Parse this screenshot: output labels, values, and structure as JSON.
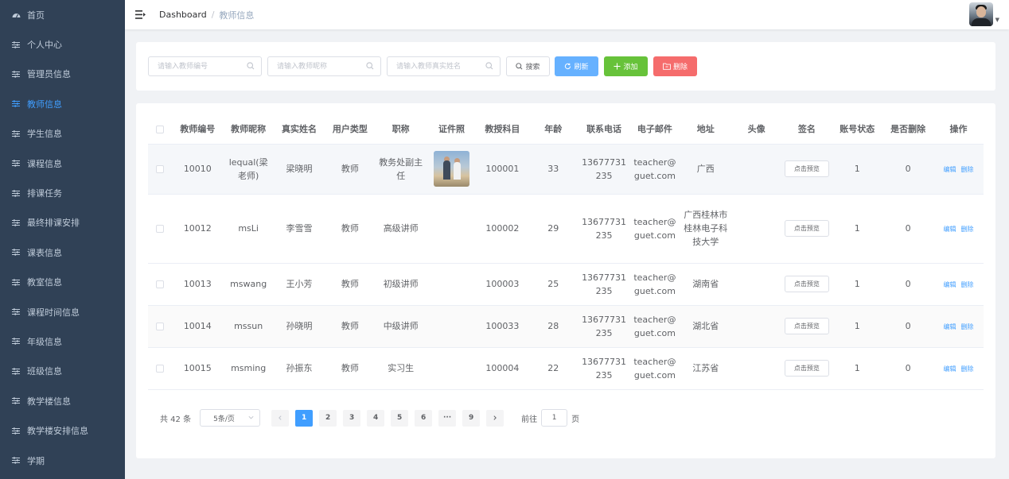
{
  "sidebar": {
    "items": [
      {
        "label": "首页",
        "active": false
      },
      {
        "label": "个人中心",
        "active": false
      },
      {
        "label": "管理员信息",
        "active": false
      },
      {
        "label": "教师信息",
        "active": true
      },
      {
        "label": "学生信息",
        "active": false
      },
      {
        "label": "课程信息",
        "active": false
      },
      {
        "label": "排课任务",
        "active": false
      },
      {
        "label": "最终排课安排",
        "active": false
      },
      {
        "label": "课表信息",
        "active": false
      },
      {
        "label": "教室信息",
        "active": false
      },
      {
        "label": "课程时间信息",
        "active": false
      },
      {
        "label": "年级信息",
        "active": false
      },
      {
        "label": "班级信息",
        "active": false
      },
      {
        "label": "教学楼信息",
        "active": false
      },
      {
        "label": "教学楼安排信息",
        "active": false
      },
      {
        "label": "学期",
        "active": false
      }
    ]
  },
  "navbar": {
    "breadcrumb_root": "Dashboard",
    "breadcrumb_sep": "/",
    "breadcrumb_current": "教师信息"
  },
  "search": {
    "teacher_no_placeholder": "请输入教师编号",
    "nickname_placeholder": "请输入教师昵称",
    "realname_placeholder": "请输入教师真实姓名",
    "search_label": "搜索",
    "refresh_label": "刷新",
    "add_label": "添加",
    "delete_label": "删除"
  },
  "table": {
    "headers": [
      "教师编号",
      "教师昵称",
      "真实姓名",
      "用户类型",
      "职称",
      "证件照",
      "教授科目",
      "年龄",
      "联系电话",
      "电子邮件",
      "地址",
      "头像",
      "签名",
      "账号状态",
      "是否删除",
      "操作"
    ],
    "rows": [
      {
        "no": "10010",
        "nickname": "lequal(梁老师)",
        "realname": "梁晓明",
        "type": "教师",
        "title": "教务处副主任",
        "subject": "100001",
        "age": "33",
        "phone": "13677731235",
        "email": "teacher@guet.com",
        "address": "广西",
        "status": "1",
        "deleted": "0",
        "has_photo": true
      },
      {
        "no": "10012",
        "nickname": "msLi",
        "realname": "李雪雪",
        "type": "教师",
        "title": "高级讲师",
        "subject": "100002",
        "age": "29",
        "phone": "13677731235",
        "email": "teacher@guet.com",
        "address": "广西桂林市桂林电子科技大学",
        "status": "1",
        "deleted": "0",
        "has_photo": false
      },
      {
        "no": "10013",
        "nickname": "mswang",
        "realname": "王小芳",
        "type": "教师",
        "title": "初级讲师",
        "subject": "100003",
        "age": "25",
        "phone": "13677731235",
        "email": "teacher@guet.com",
        "address": "湖南省",
        "status": "1",
        "deleted": "0",
        "has_photo": false
      },
      {
        "no": "10014",
        "nickname": "mssun",
        "realname": "孙晓明",
        "type": "教师",
        "title": "中级讲师",
        "subject": "100033",
        "age": "28",
        "phone": "13677731235",
        "email": "teacher@guet.com",
        "address": "湖北省",
        "status": "1",
        "deleted": "0",
        "has_photo": false
      },
      {
        "no": "10015",
        "nickname": "msming",
        "realname": "孙振东",
        "type": "教师",
        "title": "实习生",
        "subject": "100004",
        "age": "22",
        "phone": "13677731235",
        "email": "teacher@guet.com",
        "address": "江苏省",
        "status": "1",
        "deleted": "0",
        "has_photo": false
      }
    ],
    "preview_label": "点击预览",
    "edit_label": "编辑",
    "delete_label": "删除"
  },
  "pagination": {
    "total": "共 42 条",
    "page_size": "5条/页",
    "pages": [
      "1",
      "2",
      "3",
      "4",
      "5",
      "6",
      "···",
      "9"
    ],
    "current": "1",
    "goto_prefix": "前往",
    "goto_value": "1",
    "goto_suffix": "页"
  },
  "colors": {
    "sidebar_bg": "#304156",
    "accent": "#409eff",
    "success": "#67c23a",
    "danger": "#f56c6c"
  }
}
